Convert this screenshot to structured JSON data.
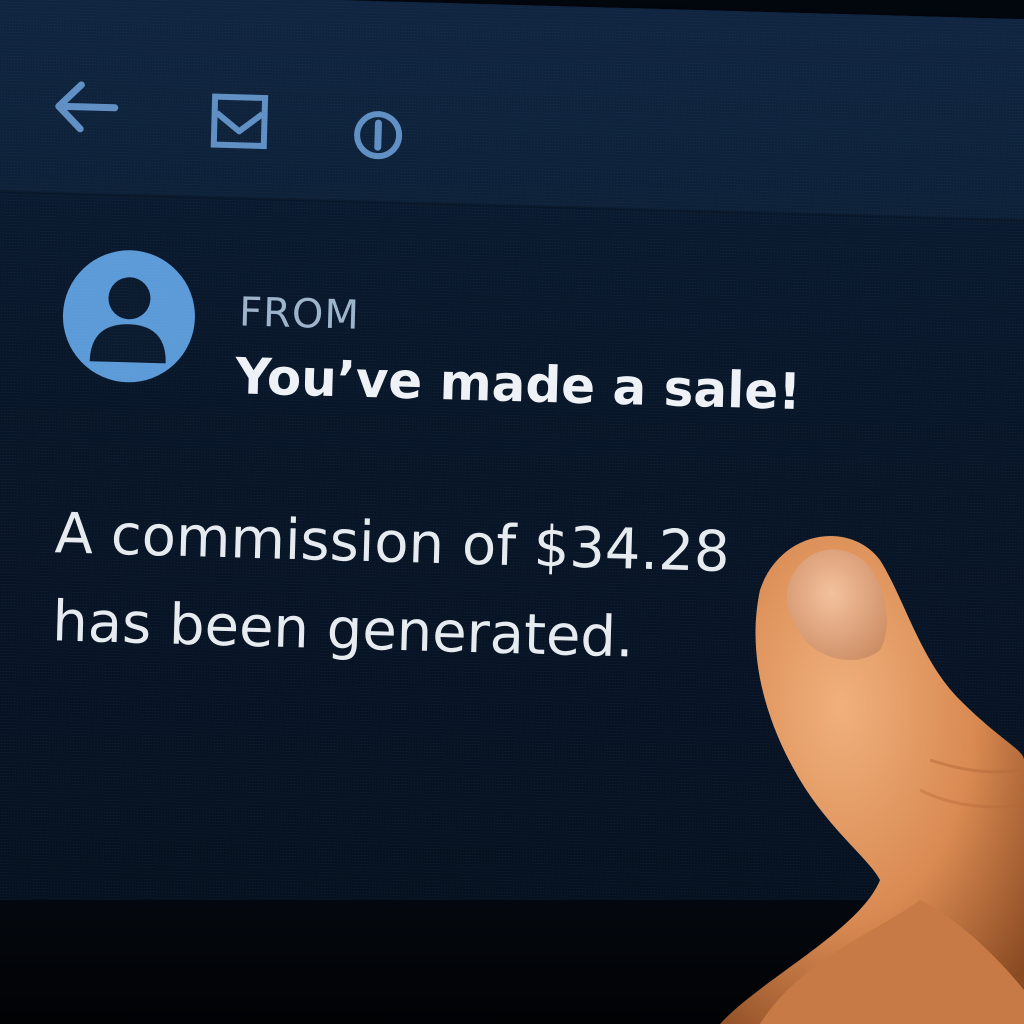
{
  "toolbar": {
    "icons": [
      "back-arrow-icon",
      "mail-icon",
      "alert-icon"
    ]
  },
  "message": {
    "from_label": "FROM",
    "subject": "You’ve made a sale!",
    "body_line_1": "A commission of $34.28",
    "body_line_2": "has been generated."
  },
  "colors": {
    "screen_background": "#071528",
    "toolbar_background": "#0f2440",
    "icon_color": "#5f8fc4",
    "avatar_color": "#5b9ad8",
    "text_color": "#e6ebf0"
  }
}
